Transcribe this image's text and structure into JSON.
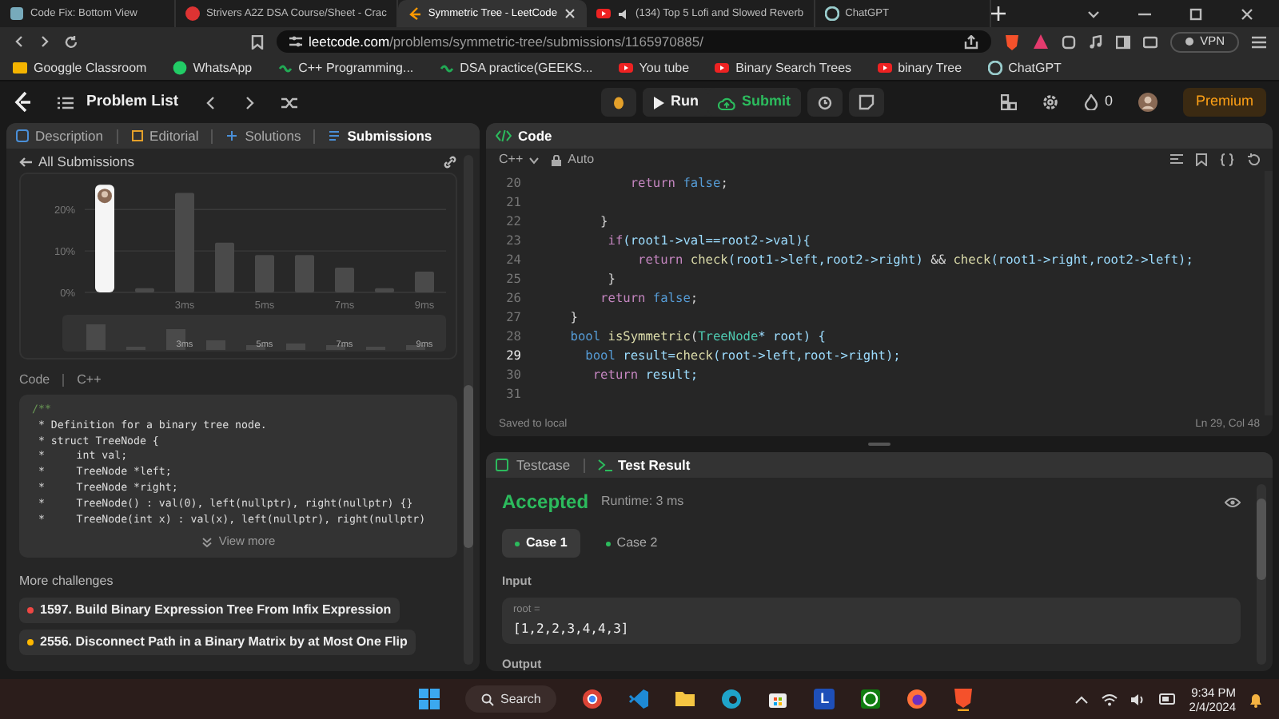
{
  "browser": {
    "tabs": [
      {
        "title": "Code Fix: Bottom View",
        "kind": "doc",
        "selected": false,
        "audio": false
      },
      {
        "title": "Strivers A2Z DSA Course/Sheet - Crac",
        "kind": "striver",
        "selected": false,
        "audio": false
      },
      {
        "title": "Symmetric Tree - LeetCode",
        "kind": "leetcode",
        "selected": true,
        "audio": false
      },
      {
        "title": "(134) Top 5 Lofi and Slowed Reverb",
        "kind": "video",
        "selected": false,
        "audio": true
      },
      {
        "title": "ChatGPT",
        "kind": "chat",
        "selected": false,
        "audio": false
      }
    ],
    "address": {
      "host": "leetcode.com",
      "path": "/problems/symmetric-tree/submissions/1165970885/"
    },
    "vpn": "VPN",
    "bookmarks": [
      {
        "label": "Googgle Classroom",
        "kind": "classroom"
      },
      {
        "label": "WhatsApp",
        "kind": "whatsapp"
      },
      {
        "label": "C++ Programming...",
        "kind": "gfg"
      },
      {
        "label": "DSA practice(GEEKS...",
        "kind": "gfg"
      },
      {
        "label": "You tube",
        "kind": "video"
      },
      {
        "label": "Binary Search Trees",
        "kind": "video"
      },
      {
        "label": "binary Tree",
        "kind": "video"
      },
      {
        "label": "ChatGPT",
        "kind": "chat"
      }
    ]
  },
  "nav": {
    "problem_list": "Problem List",
    "run": "Run",
    "submit": "Submit",
    "streak": "0",
    "premium": "Premium"
  },
  "left_panel": {
    "tabs": [
      {
        "label": "Description",
        "selected": false
      },
      {
        "label": "Editorial",
        "selected": false
      },
      {
        "label": "Solutions",
        "selected": false
      },
      {
        "label": "Submissions",
        "selected": true
      }
    ],
    "back_link": "All Submissions",
    "runtime_chart": {
      "chart_data": {
        "type": "bar",
        "x": [
          1,
          2,
          3,
          4,
          5,
          6,
          7,
          8,
          9
        ],
        "series": [
          {
            "color": "#f5f5f5",
            "values": [
              26,
              null,
              null,
              null,
              null,
              null,
              null,
              null,
              null
            ]
          },
          {
            "color": "#4a4a4a",
            "values": [
              null,
              1,
              24,
              12,
              9,
              9,
              6,
              1,
              5
            ]
          }
        ],
        "xlim": [
          0.5,
          9.5
        ],
        "ylim": [
          0,
          27
        ],
        "yticks": [
          {
            "value": 0,
            "label": "0%"
          },
          {
            "value": 10,
            "label": "10%"
          },
          {
            "value": 20,
            "label": "20%"
          }
        ],
        "xticks": [
          {
            "value": 3,
            "label": "3ms"
          },
          {
            "value": 5,
            "label": "5ms"
          },
          {
            "value": 7,
            "label": "7ms"
          },
          {
            "value": 9,
            "label": "9ms"
          }
        ]
      },
      "overview_labels": [
        "3ms",
        "5ms",
        "7ms",
        "9ms"
      ]
    },
    "code_label": "Code",
    "code_language": "C++",
    "snippet": [
      {
        "text": "/**",
        "kind": "opener"
      },
      {
        "text": " * Definition for a binary tree node.",
        "kind": "body"
      },
      {
        "text": " * struct TreeNode {",
        "kind": "body"
      },
      {
        "text": " *     int val;",
        "kind": "body"
      },
      {
        "text": " *     TreeNode *left;",
        "kind": "body"
      },
      {
        "text": " *     TreeNode *right;",
        "kind": "body"
      },
      {
        "text": " *     TreeNode() : val(0), left(nullptr), right(nullptr) {}",
        "kind": "body"
      },
      {
        "text": " *     TreeNode(int x) : val(x), left(nullptr), right(nullptr)",
        "kind": "body"
      }
    ],
    "view_more": "View more",
    "more_challenges": "More challenges",
    "challenges": [
      {
        "label": "1597. Build Binary Expression Tree From Infix Expression",
        "color": "#ef4743"
      },
      {
        "label": "2556. Disconnect Path in a Binary Matrix by at Most One Flip",
        "color": "#ffb800"
      }
    ]
  },
  "code_panel": {
    "title": "Code",
    "language": "C++",
    "mode": "Auto",
    "lines": [
      {
        "number": "20",
        "selected": false,
        "segments": [
          {
            "text": "            return ",
            "kind": "control"
          },
          {
            "text": "false",
            "kind": "keyword"
          },
          {
            "text": ";",
            "kind": "plain"
          }
        ]
      },
      {
        "number": "21",
        "selected": false
      },
      {
        "number": "22",
        "selected": false,
        "segments": [
          {
            "text": "        }",
            "kind": "plain"
          }
        ]
      },
      {
        "number": "23",
        "selected": false,
        "segments": [
          {
            "text": "         if",
            "kind": "control"
          },
          {
            "text": "(root1->val==root2->val){",
            "kind": "var"
          }
        ]
      },
      {
        "number": "24",
        "selected": false,
        "segments": [
          {
            "text": "             return ",
            "kind": "control"
          },
          {
            "text": "check",
            "kind": "func"
          },
          {
            "text": "(root1->left,root2->right)",
            "kind": "var"
          },
          {
            "text": " && ",
            "kind": "plain"
          },
          {
            "text": "check",
            "kind": "func"
          },
          {
            "text": "(root1->right,root2->left);",
            "kind": "var"
          }
        ]
      },
      {
        "number": "25",
        "selected": false,
        "segments": [
          {
            "text": "         }",
            "kind": "plain"
          }
        ]
      },
      {
        "number": "26",
        "selected": false,
        "segments": [
          {
            "text": "        return ",
            "kind": "control"
          },
          {
            "text": "false",
            "kind": "keyword"
          },
          {
            "text": ";",
            "kind": "plain"
          }
        ]
      },
      {
        "number": "27",
        "selected": false,
        "segments": [
          {
            "text": "    }",
            "kind": "plain"
          }
        ]
      },
      {
        "number": "28",
        "selected": false,
        "segments": [
          {
            "text": "    bool ",
            "kind": "keyword"
          },
          {
            "text": "isSymmetric",
            "kind": "func"
          },
          {
            "text": "(",
            "kind": "plain"
          },
          {
            "text": "TreeNode",
            "kind": "type"
          },
          {
            "text": "* root) {",
            "kind": "var"
          }
        ]
      },
      {
        "number": "29",
        "selected": true,
        "segments": [
          {
            "text": "      bool",
            "kind": "keyword"
          },
          {
            "text": " result=",
            "kind": "var"
          },
          {
            "text": "check",
            "kind": "func"
          },
          {
            "text": "(root->left,root->right);",
            "kind": "var"
          }
        ]
      },
      {
        "number": "30",
        "selected": false,
        "segments": [
          {
            "text": "       return",
            "kind": "control"
          },
          {
            "text": " result;",
            "kind": "var"
          }
        ]
      },
      {
        "number": "31",
        "selected": false
      }
    ],
    "saved": "Saved to local",
    "cursor": "Ln 29, Col 48"
  },
  "test_panel": {
    "tabs": [
      {
        "label": "Testcase",
        "selected": false
      },
      {
        "label": "Test Result",
        "selected": true
      }
    ],
    "verdict": "Accepted",
    "runtime": "Runtime: 3 ms",
    "cases": [
      {
        "label": "Case 1",
        "selected": true
      },
      {
        "label": "Case 2",
        "selected": false
      }
    ],
    "input_label": "Input",
    "param_name": "root =",
    "param_value": "[1,2,2,3,4,4,3]",
    "output_label": "Output"
  },
  "taskbar": {
    "search": "Search",
    "app_letter": "L",
    "time": "9:34 PM",
    "date": "2/4/2024"
  }
}
